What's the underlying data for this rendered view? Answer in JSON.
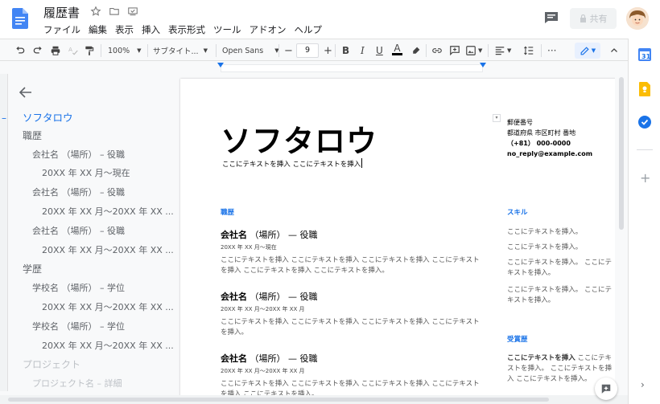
{
  "app": {
    "title": "履歴書",
    "menu": [
      "ファイル",
      "編集",
      "表示",
      "挿入",
      "表示形式",
      "ツール",
      "アドオン",
      "ヘルプ"
    ],
    "share_label": "共有"
  },
  "toolbar": {
    "zoom": "100%",
    "style": "サブタイト...",
    "font": "Open Sans",
    "font_size": "9",
    "minus": "−",
    "plus": "+",
    "bold": "B",
    "italic": "I",
    "underline": "U",
    "text_color_letter": "A",
    "more": "···"
  },
  "outline": {
    "items": [
      {
        "text": "ソフタロウ",
        "level": 0
      },
      {
        "text": "職歴",
        "level": 1
      },
      {
        "text": "会社名 （場所） – 役職",
        "level": 2
      },
      {
        "text": "20XX 年 XX 月〜現在",
        "level": 3
      },
      {
        "text": "会社名 （場所） – 役職",
        "level": 2
      },
      {
        "text": "20XX 年 XX 月〜20XX 年 XX ...",
        "level": 3
      },
      {
        "text": "会社名 （場所） – 役職",
        "level": 2
      },
      {
        "text": "20XX 年 XX 月〜20XX 年 XX ...",
        "level": 3
      },
      {
        "text": "学歴",
        "level": 1
      },
      {
        "text": "学校名 （場所） – 学位",
        "level": 2
      },
      {
        "text": "20XX 年 XX 月〜20XX 年 XX ...",
        "level": 3
      },
      {
        "text": "学校名 （場所） – 学位",
        "level": 2
      },
      {
        "text": "20XX 年 XX 月〜20XX 年 XX ...",
        "level": 3
      },
      {
        "text": "プロジェクト",
        "level": 1
      },
      {
        "text": "プロジェクト名 – 詳細",
        "level": 2
      }
    ]
  },
  "document": {
    "name": "ソフタロウ",
    "subtitle": "ここにテキストを挿入 ここにテキストを挿入",
    "contact": {
      "postal": "郵便番号",
      "address": "都道府県 市区町村 番地",
      "phone": "（+81） 000-0000",
      "email": "no_reply@example.com"
    },
    "experience_heading": "職歴",
    "jobs": [
      {
        "company": "会社名",
        "place": "（場所） — 役職",
        "date": "20XX 年 XX 月〜現在",
        "desc": "ここにテキストを挿入 ここにテキストを挿入 ここにテキストを挿入 ここにテキストを挿入 ここにテキストを挿入 ここにテキストを挿入。"
      },
      {
        "company": "会社名",
        "place": "（場所） — 役職",
        "date": "20XX 年 XX 月〜20XX 年 XX 月",
        "desc": "ここにテキストを挿入 ここにテキストを挿入 ここにテキストを挿入 ここにテキストを挿入。"
      },
      {
        "company": "会社名",
        "place": "（場所） — 役職",
        "date": "20XX 年 XX 月〜20XX 年 XX 月",
        "desc": "ここにテキストを挿入 ここにテキストを挿入 ここにテキストを挿入 ここにテキストを挿入 ここにテキストを挿入。"
      }
    ],
    "skills_heading": "スキル",
    "skills": [
      "ここにテキストを挿入。",
      "ここにテキストを挿入。",
      "ここにテキストを挿入。 ここにテキストを挿入。",
      "ここにテキストを挿入。 ここにテキストを挿入。"
    ],
    "awards_heading": "受賞歴",
    "awards_bold": "ここにテキストを挿入",
    "awards_text": " ここにテキストを挿入。 ここにテキストを挿入 ここにテキストを挿入。"
  },
  "colors": {
    "accent": "#1a73e8",
    "doc_icon": "#4285f4"
  }
}
